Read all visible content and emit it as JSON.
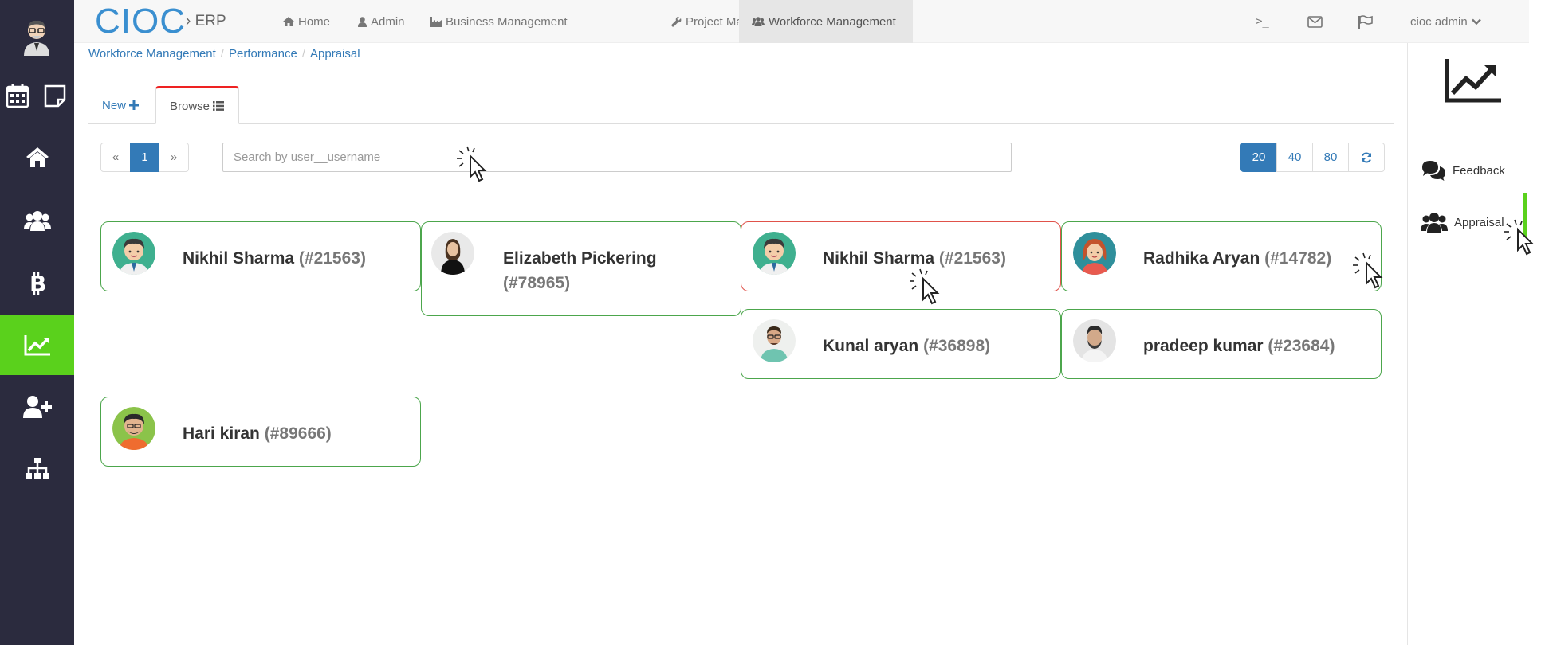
{
  "brand": {
    "name": "CIOC",
    "sub": "› ERP"
  },
  "nav": {
    "items": [
      {
        "label": "Home",
        "icon": "home-icon"
      },
      {
        "label": "Admin",
        "icon": "user-icon"
      },
      {
        "label": "Business Management",
        "icon": "industry-icon"
      },
      {
        "label": "Project Management",
        "icon": "wrench-icon"
      },
      {
        "label": "Workforce Management",
        "icon": "users-icon",
        "active": true
      }
    ],
    "terminal": ">_",
    "user": "cioc admin"
  },
  "breadcrumb": [
    "Workforce Management",
    "Performance",
    "Appraisal"
  ],
  "tabs": {
    "new": "New",
    "browse": "Browse"
  },
  "pagination": {
    "prev": "«",
    "current": "1",
    "next": "»"
  },
  "search": {
    "placeholder": "Search by user__username",
    "value": ""
  },
  "page_sizes": [
    "20",
    "40",
    "80"
  ],
  "page_size_active": "20",
  "cards": [
    {
      "name": "Nikhil Sharma",
      "id": "(#21563)"
    },
    {
      "name": "Elizabeth Pickering",
      "id": "(#78965)"
    },
    {
      "name": "Nikhil Sharma",
      "id": "(#21563)"
    },
    {
      "name": "Radhika Aryan",
      "id": "(#14782)"
    },
    {
      "name": "Kunal aryan",
      "id": "(#36898)"
    },
    {
      "name": "pradeep kumar",
      "id": "(#23684)"
    },
    {
      "name": "Hari kiran",
      "id": "(#89666)"
    }
  ],
  "right_panel": {
    "feedback": "Feedback",
    "appraisal": "Appraisal"
  },
  "sidebar": {
    "items": [
      "calendar-icon",
      "notes-icon",
      "home-icon",
      "users-icon",
      "bitcoin-icon",
      "line-chart-icon",
      "user-plus-icon",
      "sitemap-icon"
    ],
    "active": "line-chart-icon"
  },
  "colors": {
    "sidebar": "#2b2b3e",
    "active": "#5ad11c",
    "brand": "#3a8fd0",
    "link": "#337ab7",
    "card_border": "#4ca64c",
    "card_border_alert": "#e0524a"
  }
}
